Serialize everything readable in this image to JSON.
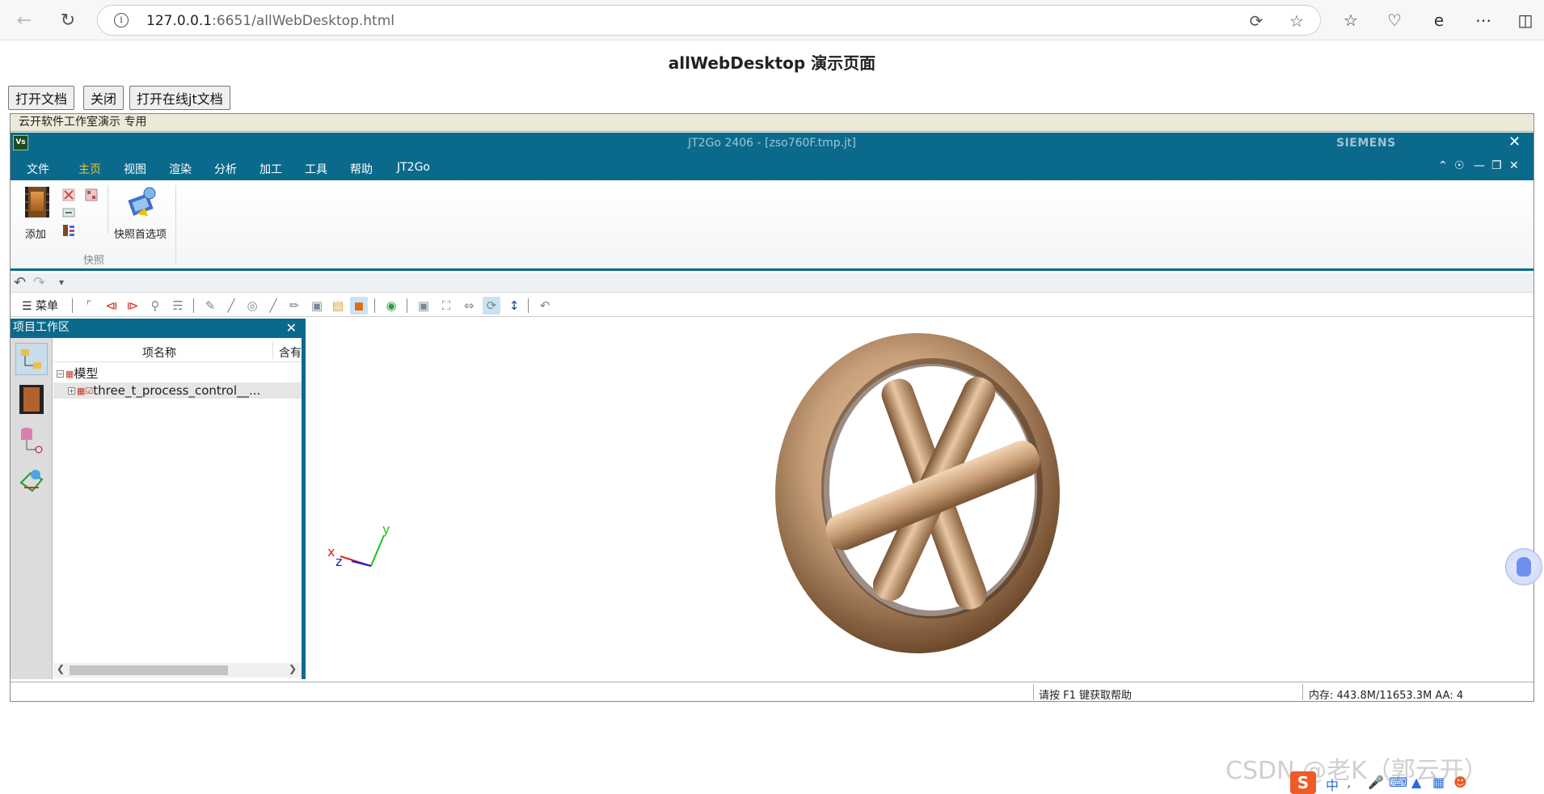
{
  "browser": {
    "url_host": "127.0.0.1",
    "url_rest": ":6651/allWebDesktop.html"
  },
  "page": {
    "title": "allWebDesktop 演示页面",
    "buttons": {
      "open_doc": "打开文档",
      "close": "关闭",
      "open_online": "打开在线jt文档"
    }
  },
  "app": {
    "demo_strip": "云开软件工作室演示  专用",
    "logo": "Vs",
    "title": "JT2Go 2406 - [zso760F.tmp.jt]",
    "brand": "SIEMENS",
    "menu": [
      {
        "label": "文件",
        "active": false
      },
      {
        "label": "主页",
        "active": true
      },
      {
        "label": "视图",
        "active": false
      },
      {
        "label": "渲染",
        "active": false
      },
      {
        "label": "分析",
        "active": false
      },
      {
        "label": "加工",
        "active": false
      },
      {
        "label": "工具",
        "active": false
      },
      {
        "label": "帮助",
        "active": false
      },
      {
        "label": "JT2Go",
        "active": false
      }
    ],
    "ribbon": {
      "add_label": "添加",
      "snapshot_pref_label": "快照首选项",
      "group_label": "快照"
    },
    "toolbar": {
      "menu_label": "菜单"
    },
    "workspace": {
      "title": "项目工作区",
      "col_name": "项名称",
      "col_contains": "含有",
      "tree": [
        {
          "label": "模型",
          "level": 0
        },
        {
          "label": "three_t_process_control__...",
          "level": 1
        }
      ]
    },
    "axes": {
      "x": "x",
      "y": "y",
      "z": "z"
    },
    "status": {
      "help": "请按 F1 键获取帮助",
      "memory": "内存: 443.8M/11653.3M   AA: 4"
    }
  },
  "watermark": "CSDN @老K（郭云开）",
  "ime": {
    "logo": "S",
    "lang": "中"
  },
  "colors": {
    "accent": "#0b6a8c",
    "active_tab": "#f2c230",
    "model": "#c8a07a"
  }
}
